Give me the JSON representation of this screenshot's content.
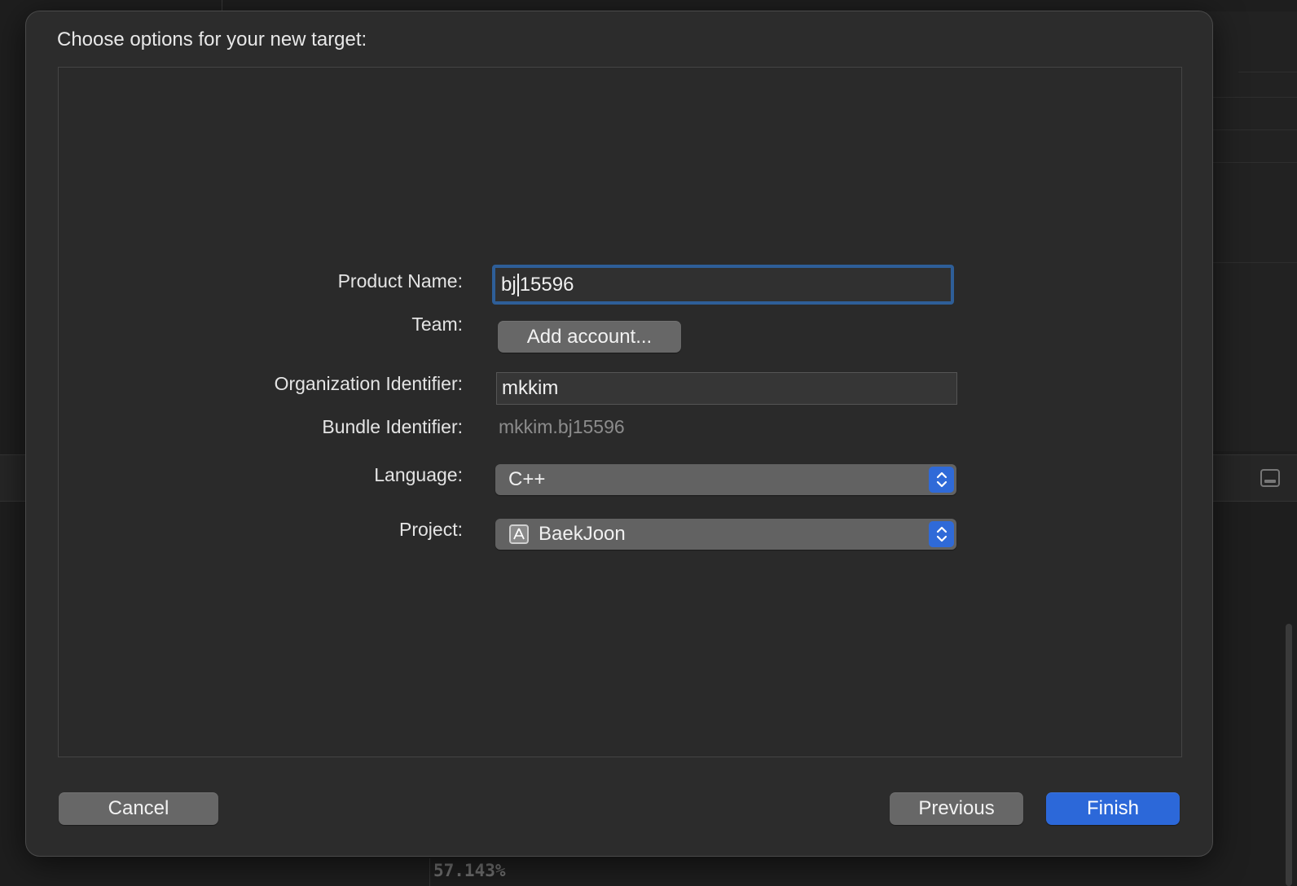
{
  "background": {
    "status_text": "57.143%"
  },
  "dialog": {
    "title": "Choose options for your new target:",
    "form": {
      "product_name": {
        "label": "Product Name:",
        "value_before_caret": "bj",
        "value_after_caret": "15596"
      },
      "team": {
        "label": "Team:",
        "button_label": "Add account..."
      },
      "organization_identifier": {
        "label": "Organization Identifier:",
        "value": "mkkim"
      },
      "bundle_identifier": {
        "label": "Bundle Identifier:",
        "value": "mkkim.bj15596"
      },
      "language": {
        "label": "Language:",
        "selected": "C++"
      },
      "project": {
        "label": "Project:",
        "selected": "BaekJoon",
        "icon": "xcode-project-icon"
      }
    },
    "buttons": {
      "cancel": "Cancel",
      "previous": "Previous",
      "finish": "Finish"
    }
  },
  "colors": {
    "accent": "#2c68d9",
    "focus_ring": "#2e5e98",
    "sheet_background": "#2c2c2c"
  }
}
